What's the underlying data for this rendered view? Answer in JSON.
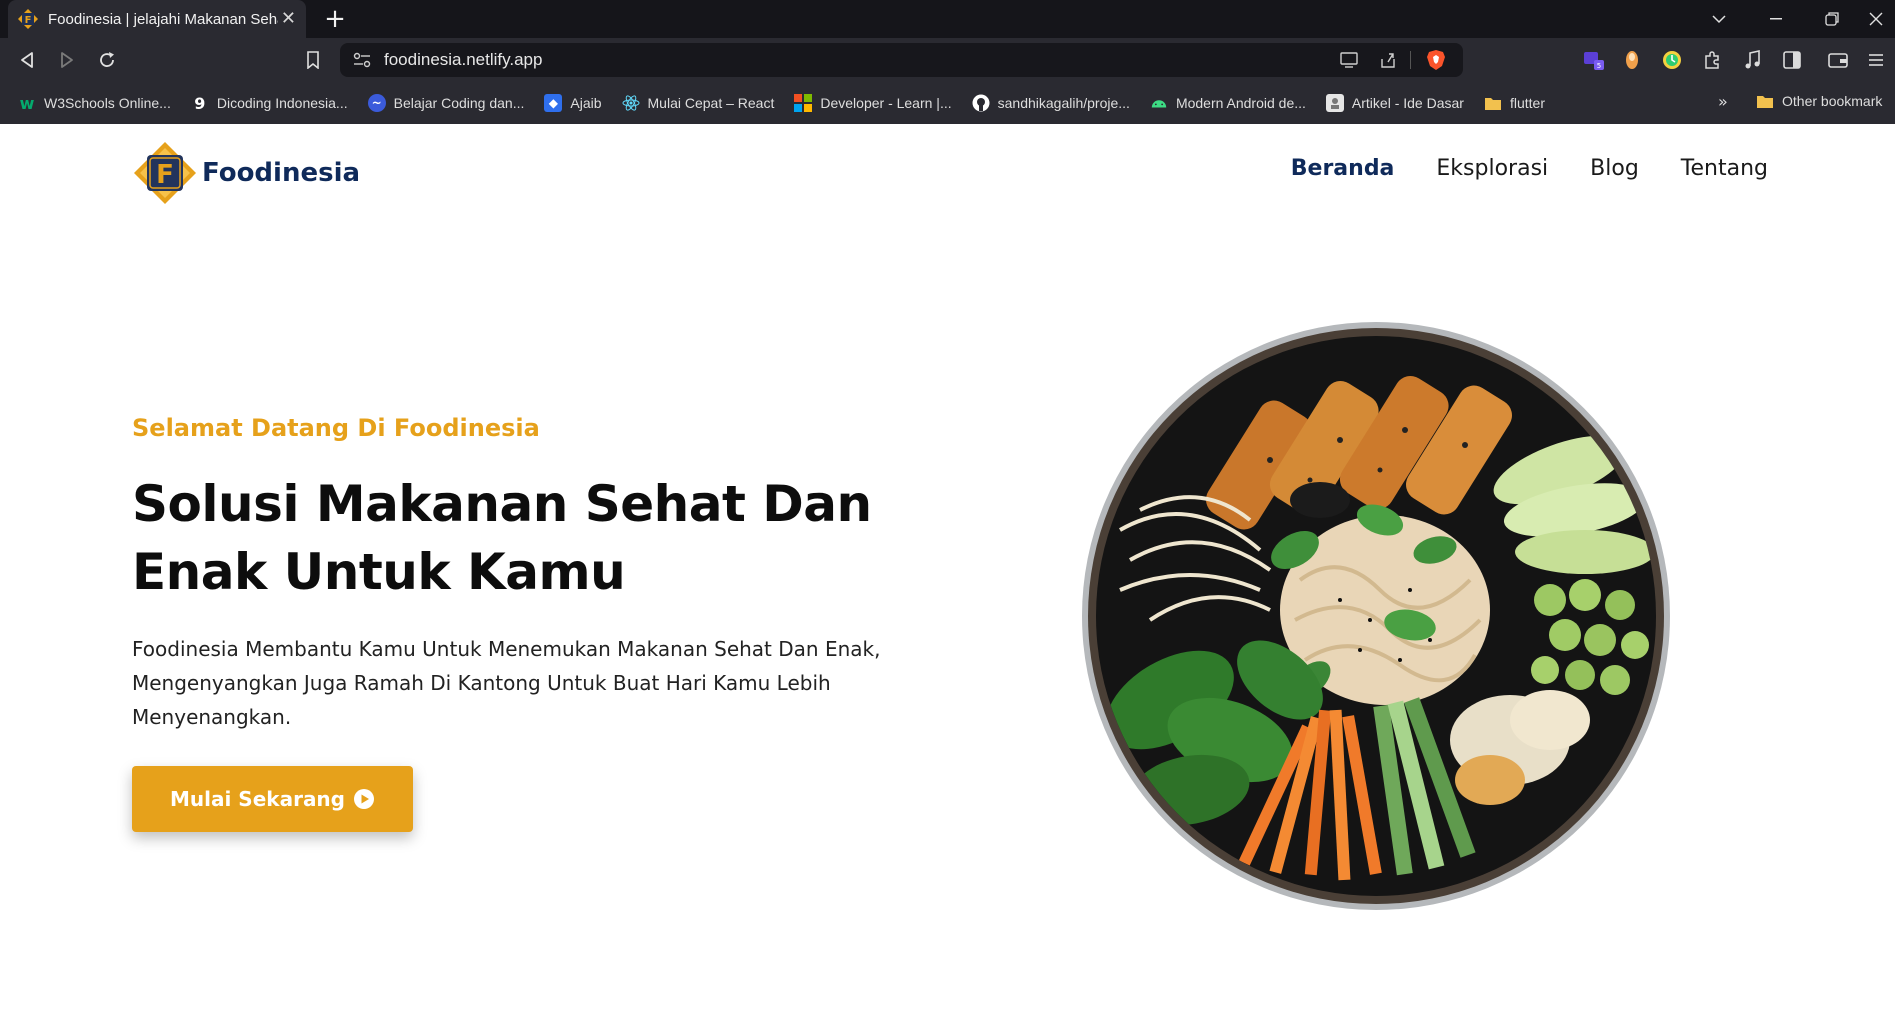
{
  "browser": {
    "tab_title": "Foodinesia | jelajahi Makanan Sehat",
    "url": "foodinesia.netlify.app",
    "bookmarks": [
      {
        "label": "W3Schools Online...",
        "icon": "w3schools-icon",
        "color": "#04aa6d"
      },
      {
        "label": "Dicoding Indonesia...",
        "icon": "dicoding-icon",
        "color": "#2d3e50"
      },
      {
        "label": "Belajar Coding dan...",
        "icon": "codepolitan-icon",
        "color": "#3b5bdb"
      },
      {
        "label": "Ajaib",
        "icon": "ajaib-icon",
        "color": "#2f6fed"
      },
      {
        "label": "Mulai Cepat – React",
        "icon": "react-icon",
        "color": "#61dafb"
      },
      {
        "label": "Developer - Learn |...",
        "icon": "microsoft-icon",
        "color": "#f25022"
      },
      {
        "label": "sandhikagalih/proje...",
        "icon": "github-icon",
        "color": "#ffffff"
      },
      {
        "label": "Modern Android de...",
        "icon": "android-icon",
        "color": "#3ddc84"
      },
      {
        "label": "Artikel - Ide Dasar",
        "icon": "article-icon",
        "color": "#cccccc"
      },
      {
        "label": "flutter",
        "icon": "folder-icon",
        "color": "#f2c14e"
      }
    ],
    "more_label": "»",
    "other_bookmarks": "Other bookmark"
  },
  "site": {
    "brand": "Foodinesia",
    "nav": [
      {
        "label": "Beranda",
        "active": true
      },
      {
        "label": "Eksplorasi",
        "active": false
      },
      {
        "label": "Blog",
        "active": false
      },
      {
        "label": "Tentang",
        "active": false
      }
    ]
  },
  "hero": {
    "eyebrow": "Selamat Datang Di Foodinesia",
    "headline_line1": "Solusi Makanan Sehat Dan",
    "headline_line2": "Enak Untuk Kamu",
    "lead_line1": "Foodinesia Membantu Kamu Untuk Menemukan Makanan Sehat Dan Enak,",
    "lead_line2": "Mengenyangkan Juga Ramah Di Kantong Untuk Buat Hari Kamu Lebih",
    "lead_line3": "Menyenangkan.",
    "cta_label": "Mulai Sekarang",
    "image": "healthy-food-bowl"
  },
  "colors": {
    "accent": "#e6a11b",
    "brand_navy": "#0f2a5a",
    "chrome_dark": "#1f1f24"
  }
}
